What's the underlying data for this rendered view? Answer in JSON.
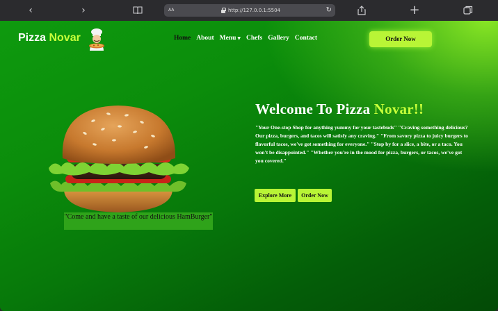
{
  "browser": {
    "url": "http://127.0.0.1:5504",
    "text_size_label": "AA",
    "icons": [
      "back-icon",
      "forward-icon",
      "reader-icon",
      "lock-icon",
      "reload-icon",
      "share-icon",
      "new-tab-icon",
      "tabs-icon"
    ]
  },
  "site": {
    "logo_word1": "Pizza",
    "logo_word2": "Novar",
    "nav": {
      "home": "Home",
      "about": "About",
      "menu": "Menu",
      "chefs": "Chefs",
      "gallery": "Gallery",
      "contact": "Contact"
    },
    "order_now": "Order Now"
  },
  "hero": {
    "title_white": "Welcome To Pizza",
    "title_green": "Novar!!",
    "paragraph": "\"Your One-stop Shop for anything yummy for your tastebuds\" \"Craving something delicious? Our pizza, burgers, and tacos will satisfy any craving.\" \"From savory pizza to juicy burgers to flavorful tacos, we've got something for everyone.\" \"Stop by for a slice, a bite, or a taco. You won't be disappointed.\" \"Whether you're in the mood for pizza, burgers, or tacos, we've got you covered.\"",
    "explore_button": "Explore More",
    "order_button": "Order Now",
    "caption": "\"Come and have a taste of our delicious HamBurger\""
  },
  "colors": {
    "accent": "#c7ff3a",
    "button": "#b8f536",
    "background": "#0b8d0b"
  }
}
